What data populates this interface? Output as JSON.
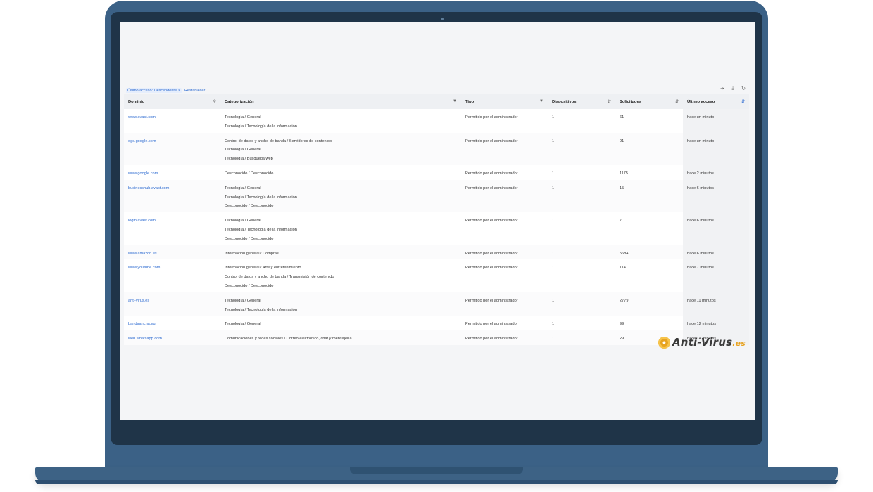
{
  "filters": {
    "active_chip": "Último acceso: Descendente",
    "chip_close": "×",
    "reset_label": "Restablecer"
  },
  "toolbar": {
    "columns_icon": "⇥",
    "download_icon": "⤓",
    "refresh_icon": "↻"
  },
  "table": {
    "headers": {
      "domain": "Dominio",
      "category": "Categorización",
      "type": "Tipo",
      "devices": "Dispositivos",
      "requests": "Solicitudes",
      "last_access": "Último acceso"
    },
    "rows": [
      {
        "domain": "www.avast.com",
        "categories": [
          "Tecnología / General",
          "Tecnología / Tecnología de la información"
        ],
        "type": "Permitido por el administrador",
        "devices": "1",
        "requests": "61",
        "last_access": "hace un minuto"
      },
      {
        "domain": "ogs.google.com",
        "categories": [
          "Control de datos y ancho de banda / Servidores de contenido",
          "Tecnología / General",
          "Tecnología / Búsqueda web"
        ],
        "type": "Permitido por el administrador",
        "devices": "1",
        "requests": "91",
        "last_access": "hace un minuto"
      },
      {
        "domain": "www.google.com",
        "categories": [
          "Desconocido / Desconocido"
        ],
        "type": "Permitido por el administrador",
        "devices": "1",
        "requests": "1175",
        "last_access": "hace 2 minutos"
      },
      {
        "domain": "businesshub.avast.com",
        "categories": [
          "Tecnología / General",
          "Tecnología / Tecnología de la información",
          "Desconocido / Desconocido"
        ],
        "type": "Permitido por el administrador",
        "devices": "1",
        "requests": "15",
        "last_access": "hace 6 minutos"
      },
      {
        "domain": "login.avast.com",
        "categories": [
          "Tecnología / General",
          "Tecnología / Tecnología de la información",
          "Desconocido / Desconocido"
        ],
        "type": "Permitido por el administrador",
        "devices": "1",
        "requests": "7",
        "last_access": "hace 6 minutos"
      },
      {
        "domain": "www.amazon.es",
        "categories": [
          "Información general / Compras"
        ],
        "type": "Permitido por el administrador",
        "devices": "1",
        "requests": "5684",
        "last_access": "hace 6 minutos"
      },
      {
        "domain": "www.youtube.com",
        "categories": [
          "Información general / Arte y entretenimiento",
          "Control de datos y ancho de banda / Transmisión de contenido",
          "Desconocido / Desconocido"
        ],
        "type": "Permitido por el administrador",
        "devices": "1",
        "requests": "114",
        "last_access": "hace 7 minutos"
      },
      {
        "domain": "anti-virus.es",
        "categories": [
          "Tecnología / General",
          "Tecnología / Tecnología de la información"
        ],
        "type": "Permitido por el administrador",
        "devices": "1",
        "requests": "2779",
        "last_access": "hace 11 minutos"
      },
      {
        "domain": "bandaancha.eu",
        "categories": [
          "Tecnología / General"
        ],
        "type": "Permitido por el administrador",
        "devices": "1",
        "requests": "99",
        "last_access": "hace 12 minutos"
      },
      {
        "domain": "web.whatsapp.com",
        "categories": [
          "Comunicaciones y redes sociales / Correo electrónico, chat y mensajería"
        ],
        "type": "Permitido por el administrador",
        "devices": "1",
        "requests": "29",
        "last_access": "hace 14 minutos"
      }
    ]
  },
  "watermark": {
    "brand": "Anti-Virus",
    "tld": ".es"
  }
}
